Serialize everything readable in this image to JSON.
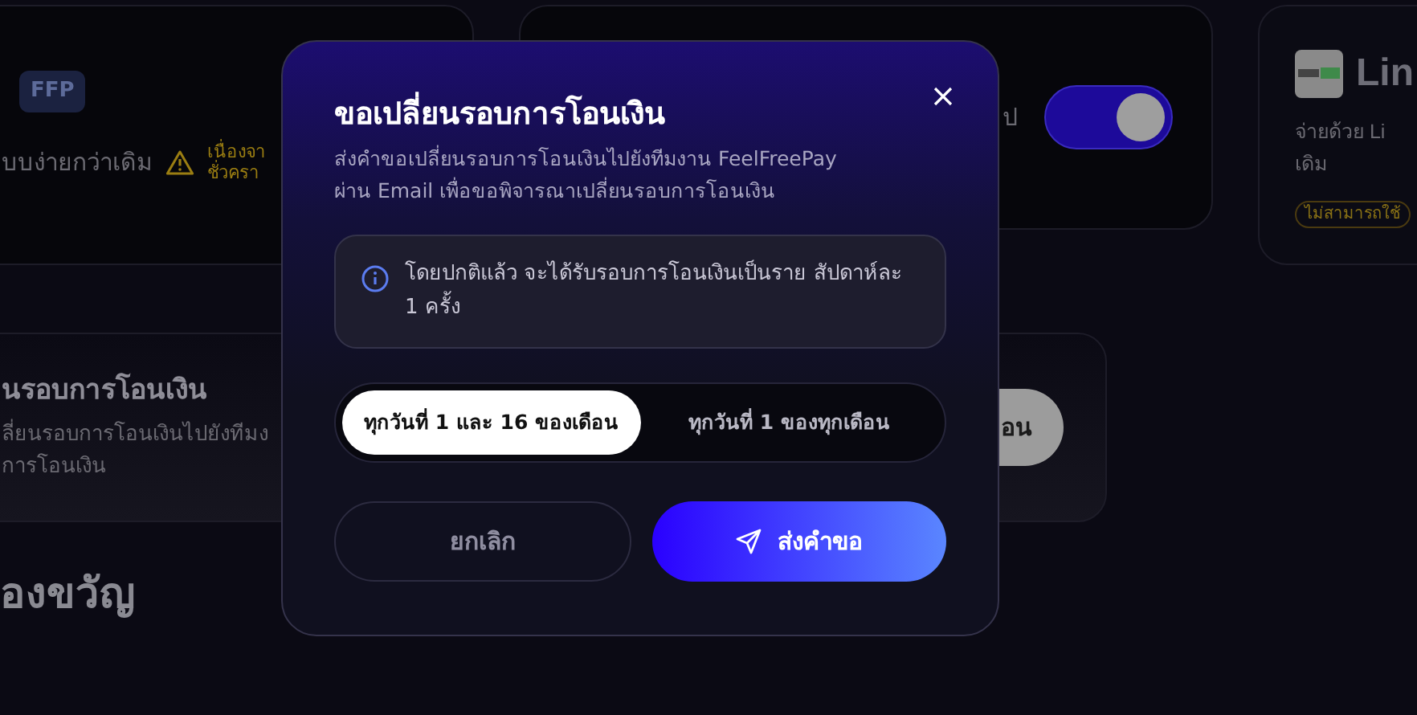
{
  "bg_card_1": {
    "badge": "FFP",
    "description": "บบง่ายกว่าเดิม",
    "warning": [
      "เนื่องจา",
      "ชั่วครา"
    ]
  },
  "bg_card_2": {
    "description": "ป",
    "toggle": {
      "on": true
    }
  },
  "bg_card_3": {
    "title": "Lin",
    "description": [
      "จ่ายด้วย Li",
      "เดิม"
    ],
    "badge": "ไม่สามารถใช้"
  },
  "bg_card_4": {
    "title": "นรอบการโอนเงิน",
    "description": [
      "ลี่ยนรอบการโอนเงินไปยังทีมง",
      "การโอนเงิน"
    ],
    "button": "อน"
  },
  "section_heading": "องขวัญ",
  "dialog": {
    "title": "ขอเปลี่ยนรอบการโอนเงิน",
    "subtitle": [
      "ส่งคำขอเปลี่ยนรอบการโอนเงินไปยังทีมงาน FeelFreePay",
      "ผ่าน Email เพื่อขอพิจารณาเปลี่ยนรอบการโอนเงิน"
    ],
    "info": "โดยปกติแล้ว จะได้รับรอบการโอนเงินเป็นราย สัปดาห์ละ 1 ครั้ง",
    "options": [
      {
        "label": "ทุกวันที่ 1 และ 16 ของเดือน",
        "selected": true
      },
      {
        "label": "ทุกวันที่ 1 ของทุกเดือน",
        "selected": false
      }
    ],
    "buttons": [
      {
        "kind": "cancel",
        "label": "ยกเลิก"
      },
      {
        "kind": "submit",
        "label": "ส่งคำขอ"
      }
    ]
  }
}
